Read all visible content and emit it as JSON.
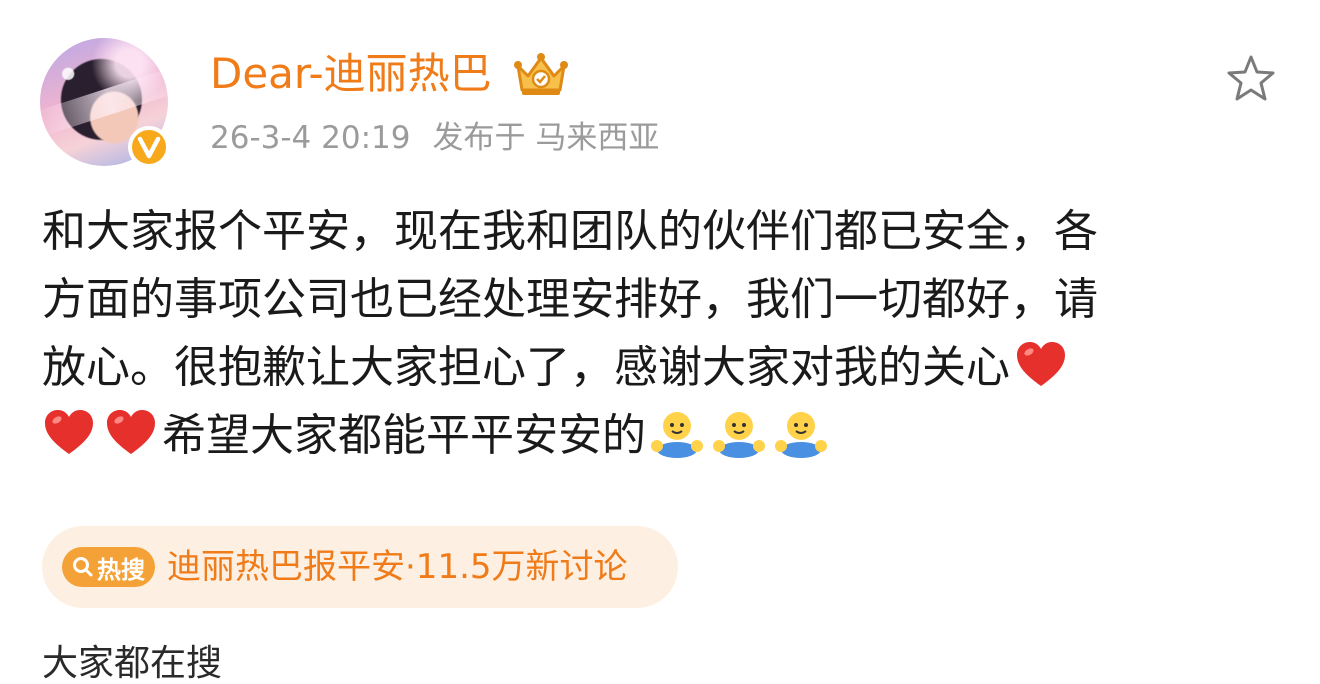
{
  "post": {
    "username": "Dear-迪丽热巴",
    "timestamp": "26-3-4 20:19",
    "location": "发布于 马来西亚",
    "content_lines": [
      "和大家报个平安，现在我和团队的伙伴们都已安全，各",
      "方面的事项公司也已经处理安排好，我们一切都好，请",
      "放心。很抱歉让大家担心了，感谢大家对我的关心",
      "希望大家都能平平安安的"
    ]
  },
  "hot_search": {
    "badge_icon": "search-icon",
    "badge_label": "热搜",
    "text": "迪丽热巴报平安·11.5万新讨论"
  },
  "section_title": "大家都在搜",
  "icons": {
    "verified": "verified-v-badge-icon",
    "crown": "vip-crown-icon",
    "star": "favorite-star-icon",
    "heart": "red-heart-emoji",
    "bear": "hug-emoji"
  },
  "colors": {
    "accent": "#f07b19",
    "meta": "#9b9b9b",
    "hot_bg": "#fdf0e3",
    "hot_badge": "#f4a238",
    "verified": "#f7a81b"
  }
}
